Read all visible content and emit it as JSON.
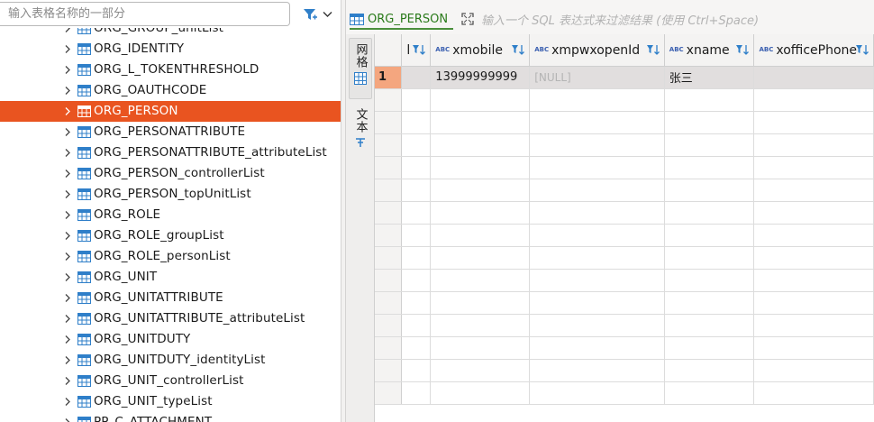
{
  "filter": {
    "placeholder": "输入表格名称的一部分"
  },
  "tree": {
    "items": [
      {
        "label": "ORG_GROUP_unitList",
        "selected": false
      },
      {
        "label": "ORG_IDENTITY",
        "selected": false
      },
      {
        "label": "ORG_L_TOKENTHRESHOLD",
        "selected": false
      },
      {
        "label": "ORG_OAUTHCODE",
        "selected": false
      },
      {
        "label": "ORG_PERSON",
        "selected": true
      },
      {
        "label": "ORG_PERSONATTRIBUTE",
        "selected": false
      },
      {
        "label": "ORG_PERSONATTRIBUTE_attributeList",
        "selected": false
      },
      {
        "label": "ORG_PERSON_controllerList",
        "selected": false
      },
      {
        "label": "ORG_PERSON_topUnitList",
        "selected": false
      },
      {
        "label": "ORG_ROLE",
        "selected": false
      },
      {
        "label": "ORG_ROLE_groupList",
        "selected": false
      },
      {
        "label": "ORG_ROLE_personList",
        "selected": false
      },
      {
        "label": "ORG_UNIT",
        "selected": false
      },
      {
        "label": "ORG_UNITATTRIBUTE",
        "selected": false
      },
      {
        "label": "ORG_UNITATTRIBUTE_attributeList",
        "selected": false
      },
      {
        "label": "ORG_UNITDUTY",
        "selected": false
      },
      {
        "label": "ORG_UNITDUTY_identityList",
        "selected": false
      },
      {
        "label": "ORG_UNIT_controllerList",
        "selected": false
      },
      {
        "label": "ORG_UNIT_typeList",
        "selected": false
      },
      {
        "label": "PP_C_ATTACHMENT",
        "selected": false
      }
    ]
  },
  "editor": {
    "tab_label": "ORG_PERSON",
    "sql_placeholder": "输入一个 SQL 表达式来过滤结果 (使用 Ctrl+Space)",
    "vertical_tabs": [
      {
        "label": "网格",
        "active": true
      },
      {
        "label": "文本",
        "active": false
      }
    ]
  },
  "grid": {
    "columns": [
      {
        "name": "l",
        "type_icon": ""
      },
      {
        "name": "xmobile",
        "type_icon": "ABC"
      },
      {
        "name": "xmpwxopenId",
        "type_icon": "ABC"
      },
      {
        "name": "xname",
        "type_icon": "ABC"
      },
      {
        "name": "xofficePhone",
        "type_icon": "ABC"
      }
    ],
    "rows": [
      {
        "num": "1",
        "cells": [
          "",
          "13999999999",
          "[NULL]",
          "张三",
          ""
        ]
      }
    ],
    "empty_rows": 14
  },
  "colors": {
    "selected_row": "#e95420",
    "tab_accent": "#2a7a1a",
    "row_highlight": "#f4a67f"
  }
}
